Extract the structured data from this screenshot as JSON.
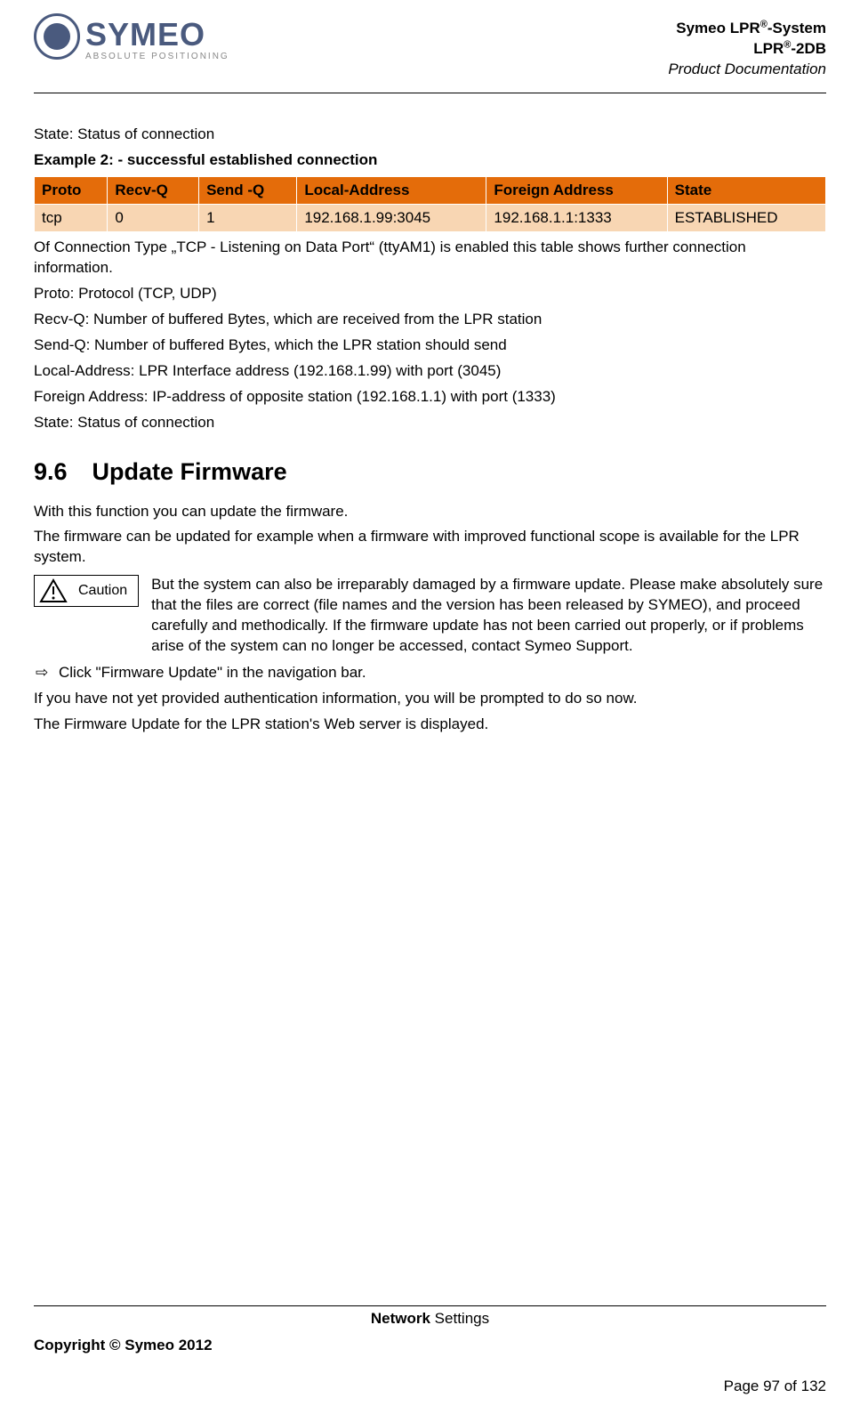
{
  "header": {
    "logo_main": "SYMEO",
    "logo_sub": "ABSOLUTE POSITIONING",
    "right_line1_prefix": "Symeo LPR",
    "right_line1_sup": "®",
    "right_line1_suffix": "-System",
    "right_line2_prefix": "LPR",
    "right_line2_sup": "®",
    "right_line2_suffix": "-2DB",
    "right_line3": "Product Documentation"
  },
  "body": {
    "p_state1": "State: Status of connection",
    "p_example": "Example 2: - successful established connection",
    "table": {
      "headers": [
        "Proto",
        "Recv-Q",
        "Send -Q",
        "Local-Address",
        "Foreign Address",
        "State"
      ],
      "row": [
        "tcp",
        "0",
        "1",
        "192.168.1.99:3045",
        "192.168.1.1:1333",
        "ESTABLISHED"
      ]
    },
    "p_after_table": "Of Connection Type „TCP - Listening on Data Port“ (ttyAM1) is enabled this table shows further connection information.",
    "p_proto": "Proto: Protocol (TCP, UDP)",
    "p_recvq": "Recv-Q: Number of buffered Bytes, which are received from the LPR station",
    "p_sendq": "Send-Q: Number of buffered Bytes, which the LPR station should send",
    "p_local": "Local-Address: LPR Interface address (192.168.1.99) with port (3045)",
    "p_foreign": "Foreign Address: IP-address of opposite station (192.168.1.1) with port (1333)",
    "p_state2": "State: Status of connection",
    "section_num": "9.6",
    "section_title": "Update Firmware",
    "p_func": "With this function you can update the firmware.",
    "p_fw_scope": "The firmware can be updated for example when a firmware with improved functional scope is available for the LPR system.",
    "caution_label": "Caution",
    "caution_text": "But the system can also be irreparably damaged by a firmware update. Please make absolutely sure that the files are correct (file names and the version has been released by SYMEO), and proceed carefully and methodically. If the firmware update has not been carried out properly, or if problems arise of the system can no longer be accessed, contact Symeo Support.",
    "arrow_text": "Click \"Firmware Update\" in the navigation bar.",
    "p_auth": "If you have not yet provided authentication information, you will be prompted to do so now.",
    "p_display": "The Firmware Update for the LPR station's Web server is displayed."
  },
  "footer": {
    "section_bold": "Network",
    "section_rest": " Settings",
    "copyright": "Copyright © Symeo 2012",
    "page": "Page 97 of 132"
  }
}
